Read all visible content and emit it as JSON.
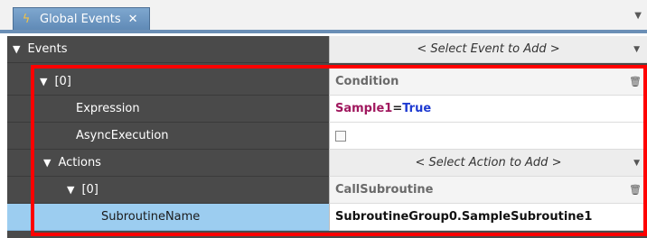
{
  "tab": {
    "icon": "lightning-bolt-icon",
    "title": "Global Events",
    "close": "✕"
  },
  "events": {
    "label": "Events",
    "add_placeholder": "< Select Event to Add >"
  },
  "event0": {
    "label": "[0]",
    "type": "Condition",
    "expression_label": "Expression",
    "expression_left": "Sample1",
    "expression_op": "=",
    "expression_right": "True",
    "async_label": "AsyncExecution",
    "async_checked": false,
    "actions_label": "Actions",
    "actions_add_placeholder": "< Select Action to Add >",
    "action0": {
      "label": "[0]",
      "type": "CallSubroutine",
      "param_label": "SubroutineName",
      "param_value": "SubroutineGroup0.SampleSubroutine1"
    }
  },
  "colors": {
    "highlight": "#ff0000",
    "selected_row": "#9ccdf0",
    "tab_accent": "#6b8fb6",
    "expr_variable": "#a0185e",
    "expr_literal": "#1f3bd1"
  }
}
